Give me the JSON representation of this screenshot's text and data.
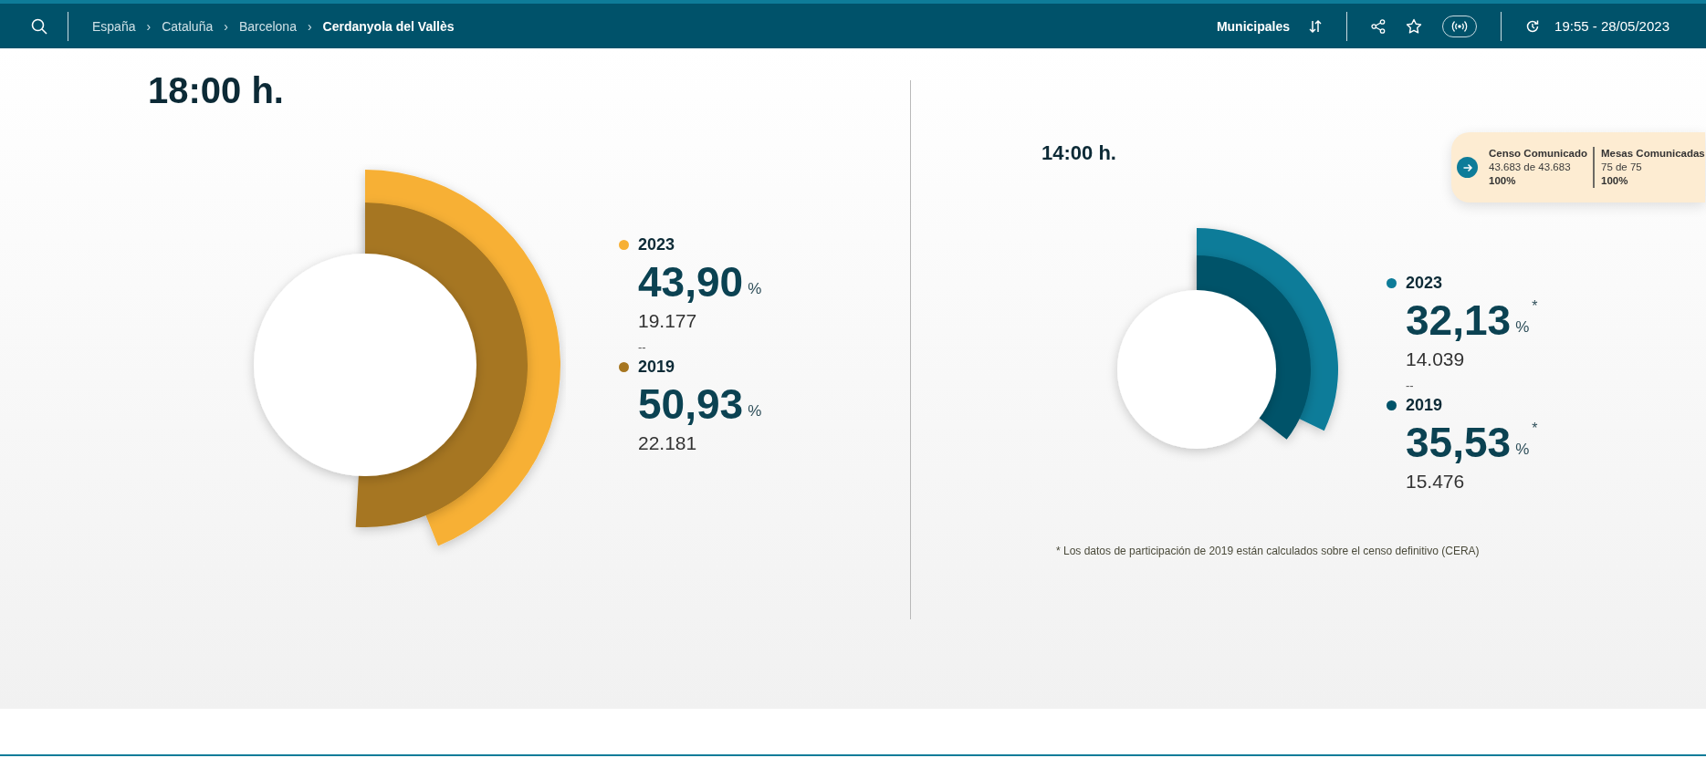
{
  "header": {
    "breadcrumbs": [
      {
        "label": "España",
        "current": false
      },
      {
        "label": "Cataluña",
        "current": false
      },
      {
        "label": "Barcelona",
        "current": false
      },
      {
        "label": "Cerdanyola del Vallès",
        "current": true
      }
    ],
    "separator": "›",
    "election": "Municipales",
    "time": "19:55 - 28/05/2023"
  },
  "panels": [
    {
      "title": "18:00 h.",
      "kind": "primary",
      "series": [
        {
          "year": "2023",
          "color": "#f7b035",
          "percent": "43,90",
          "unit": "%",
          "votes": "19.177"
        },
        {
          "year": "2019",
          "color": "#a67621",
          "percent": "50,93",
          "unit": "%",
          "votes": "22.181"
        }
      ],
      "separator": "--"
    },
    {
      "title": "14:00 h.",
      "kind": "secondary",
      "series": [
        {
          "year": "2023",
          "color": "#0e7c99",
          "percent": "32,13",
          "unit": "%",
          "note": "*",
          "votes": "14.039"
        },
        {
          "year": "2019",
          "color": "#005369",
          "percent": "35,53",
          "unit": "%",
          "note": "*",
          "votes": "15.476"
        }
      ],
      "separator": "--",
      "footnote": "* Los datos de participación de 2019 están calculados sobre el censo definitivo (CERA)"
    }
  ],
  "summary": {
    "items": [
      {
        "label": "Censo Comunicado",
        "detail": "43.683 de 43.683",
        "percent": "100%"
      },
      {
        "label": "Mesas Comunicadas",
        "detail": "75 de 75",
        "percent": "100%"
      }
    ]
  }
}
